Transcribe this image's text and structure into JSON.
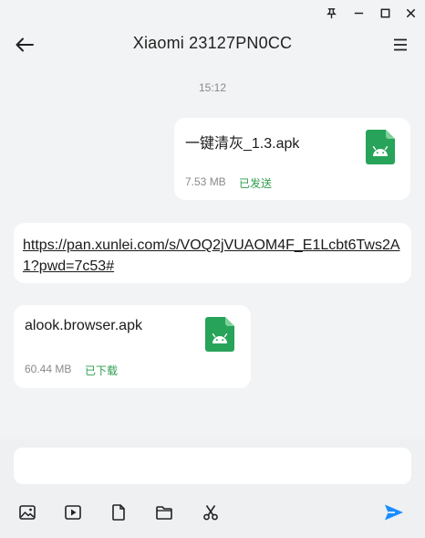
{
  "header": {
    "title": "Xiaomi 23127PN0CC"
  },
  "timestamp": "15:12",
  "messages": [
    {
      "type": "file",
      "direction": "outgoing",
      "name": "一键清灰_1.3.apk",
      "size": "7.53 MB",
      "status": "已发送"
    },
    {
      "type": "link",
      "direction": "incoming",
      "text": "https://pan.xunlei.com/s/VOQ2jVUAOM4F_E1Lcbt6Tws2A1?pwd=7c53#"
    },
    {
      "type": "file",
      "direction": "incoming",
      "name": "alook.browser.apk",
      "size": "60.44 MB",
      "status": "已下载"
    }
  ],
  "composer": {
    "placeholder": "",
    "tools": [
      "image-icon",
      "video-icon",
      "file-icon",
      "folder-icon",
      "cut-icon"
    ],
    "send_icon": "send-icon"
  },
  "colors": {
    "background": "#f2f3f5",
    "bubble": "#ffffff",
    "accent_green": "#2e9d4e",
    "file_icon": "#27a35a",
    "send_blue": "#1a8cff"
  }
}
